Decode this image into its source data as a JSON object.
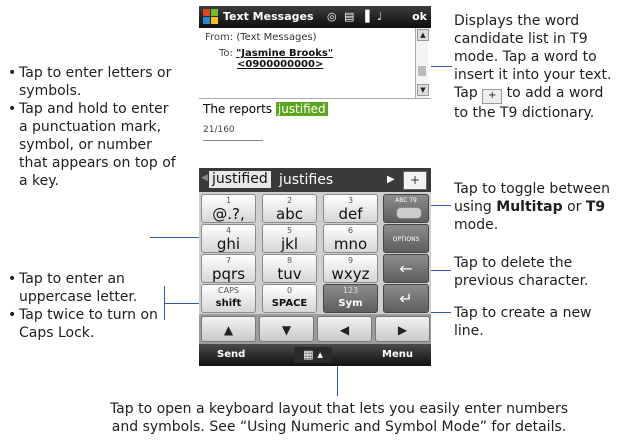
{
  "annotations": {
    "candidate": [
      "Displays the word",
      "candidate list in T9",
      "mode. Tap a word to",
      "insert it into your text.",
      "Tap",
      "to add a word",
      "to the T9 dictionary."
    ],
    "letters": [
      "Tap to enter letters or symbols.",
      "Tap and hold to enter a punctuation mark, symbol, or number that appears on top of a key."
    ],
    "toggle_pre": "Tap to toggle between using ",
    "toggle_mt": "Multitap",
    "toggle_or": " or ",
    "toggle_t9": "T9",
    "toggle_post": " mode.",
    "delete": "Tap to delete the previous character.",
    "shift": [
      "Tap to enter an uppercase letter.",
      "Tap twice to turn on Caps Lock."
    ],
    "newline": "Tap to create a new line.",
    "sym": "Tap to open a keyboard layout that lets you easily enter numbers and symbols. See “Using Numeric and Symbol Mode” for details."
  },
  "phone": {
    "title": "Text Messages",
    "ok": "ok",
    "from_label": "From:",
    "from_value": "(Text Messages)",
    "to_label": "To:",
    "to_name": "\"Jasmine Brooks\"",
    "to_number": "<0900000000>",
    "body_prefix": "The reports ",
    "body_highlight": "justified",
    "counter": "21/160",
    "candidates": [
      "justified",
      "justifies"
    ],
    "plus": "+",
    "keys": [
      {
        "n": "1",
        "m": "@.?,"
      },
      {
        "n": "2",
        "m": "abc"
      },
      {
        "n": "3",
        "m": "def"
      },
      {
        "n": "4",
        "m": "ghi"
      },
      {
        "n": "5",
        "m": "jkl"
      },
      {
        "n": "6",
        "m": "mno"
      },
      {
        "n": "7",
        "m": "pqrs"
      },
      {
        "n": "8",
        "m": "tuv"
      },
      {
        "n": "9",
        "m": "wxyz"
      },
      {
        "n": "CAPS",
        "m": "shift"
      },
      {
        "n": "0",
        "m": "SPACE"
      },
      {
        "n": "123",
        "m": "Sym"
      }
    ],
    "abc_t9": "ABC T9",
    "options": "OPTIONS",
    "soft_left": "Send",
    "soft_right": "Menu"
  }
}
